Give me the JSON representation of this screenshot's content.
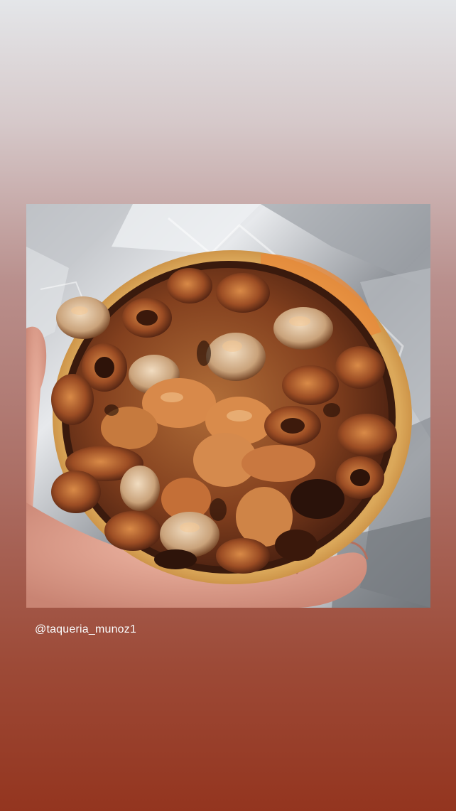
{
  "story": {
    "background_colors": [
      "#e4e6e9",
      "#d6c9ca",
      "#b98f8c",
      "#ab6d63",
      "#9d4a37",
      "#94351f"
    ],
    "photo": {
      "subject": "tripe taco on a tortilla held in hand over aluminum foil"
    },
    "mention": "@taqueria_munoz1"
  }
}
